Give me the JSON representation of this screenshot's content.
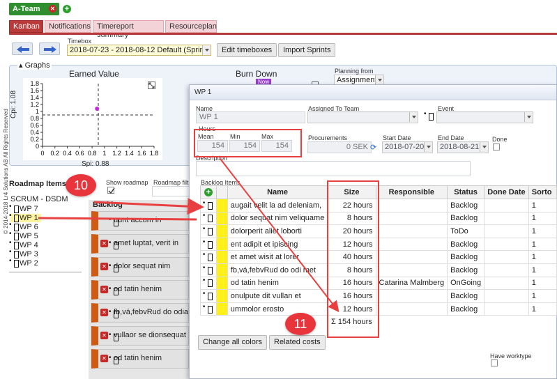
{
  "side_text": "© 2014-2018 Lr4 Solutions AB All Rights Reserved",
  "team_tab": {
    "label": "A-Team"
  },
  "nav_tabs": [
    "Kanban",
    "Notifications",
    "Timereport summary",
    "Resourceplan"
  ],
  "timebox": {
    "label": "Timebox",
    "value": "2018-07-23 - 2018-08-12 Default (Sprint)"
  },
  "toolbar": {
    "edit_timeboxes": "Edit timeboxes",
    "import_sprints": "Import Sprints"
  },
  "graphs": {
    "legend": "Graphs",
    "earned_value_title": "Earned Value",
    "burn_down_title": "Burn Down",
    "new_badge": "Now",
    "y_axis_label": "Cpi: 1.08",
    "x_axis_label": "Spi: 0.88",
    "y_ticks": [
      "1.8",
      "1.6",
      "1.4",
      "1.2",
      "1",
      "0.8",
      "0.6",
      "0.4",
      "0.2",
      "0"
    ],
    "x_ticks": [
      "0",
      "0.2",
      "0.4",
      "0.6",
      "0.8",
      "1",
      "1.2",
      "1.4",
      "1.6",
      "1.8"
    ],
    "planning_from_label": "Planning from",
    "planning_from_value": "Assignment"
  },
  "chart_data": {
    "type": "scatter",
    "title": "Earned Value",
    "xlabel": "Spi: 0.88",
    "ylabel": "Cpi: 1.08",
    "xlim": [
      0,
      1.8
    ],
    "ylim": [
      0,
      1.8
    ],
    "points": [
      {
        "x": 0.88,
        "y": 1.08
      }
    ],
    "reference_lines": {
      "x": 0.9,
      "y": 0.9
    },
    "grid": false
  },
  "roadmap": {
    "title": "Roadmap Items",
    "show_roadmap": "Show roadmap",
    "roadmap_filter": "Roadmap filte",
    "root": "SCRUM - DSDM",
    "items": [
      "WP 7",
      "WP 1",
      "WP 6",
      "WP 5",
      "WP 4",
      "WP 3",
      "WP 2"
    ],
    "selected": "WP 1"
  },
  "backlog": {
    "title": "Backlog",
    "cards": [
      "uunt accum in",
      "amet luptat, verit in",
      "dolor sequat nim",
      "od tatin henim",
      "fb,vá,febvRud do odiar",
      "vullaor se dionsequat",
      "od tatin henim"
    ]
  },
  "modal": {
    "title": "WP 1",
    "name_label": "Name",
    "name_value": "WP 1",
    "assigned_label": "Assigned To Team",
    "event_label": "Event",
    "hours_label": "Hours",
    "mean_label": "Mean",
    "min_label": "Min",
    "max_label": "Max",
    "mean_value": "154",
    "min_value": "154",
    "max_value": "154",
    "procurements_label": "Procurements",
    "procurements_value": "0 SEK",
    "start_date_label": "Start Date",
    "start_date_value": "2018-07-20",
    "end_date_label": "End Date",
    "end_date_value": "2018-08-21",
    "done_label": "Done",
    "description_label": "Description",
    "backlog_items_label": "Backlog Items",
    "columns": [
      "",
      "",
      "Name",
      "Size",
      "Responsible",
      "Status",
      "Done Date",
      "Sorto"
    ],
    "rows": [
      {
        "name": "augait velit la ad deleniam,",
        "size": "22 hours",
        "responsible": "",
        "status": "Backlog",
        "done_date": "",
        "sort": "1"
      },
      {
        "name": "dolor sequat nim veliquame",
        "size": "8 hours",
        "responsible": "",
        "status": "Backlog",
        "done_date": "",
        "sort": "1"
      },
      {
        "name": "dolorperit aliet loborti",
        "size": "20 hours",
        "responsible": "",
        "status": "ToDo",
        "done_date": "",
        "sort": "1"
      },
      {
        "name": "ent adipit et ipiscing",
        "size": "12 hours",
        "responsible": "",
        "status": "Backlog",
        "done_date": "",
        "sort": "1"
      },
      {
        "name": "et amet wisit at lorer",
        "size": "40 hours",
        "responsible": "",
        "status": "Backlog",
        "done_date": "",
        "sort": "1"
      },
      {
        "name": "fb,vá,febvRud do odi met",
        "size": "8 hours",
        "responsible": "",
        "status": "Backlog",
        "done_date": "",
        "sort": "1"
      },
      {
        "name": "od tatin henim",
        "size": "16 hours",
        "responsible": "Catarina Malmberg",
        "status": "OnGoing",
        "done_date": "",
        "sort": "1"
      },
      {
        "name": "onulpute dit vullan et",
        "size": "16 hours",
        "responsible": "",
        "status": "Backlog",
        "done_date": "",
        "sort": "1"
      },
      {
        "name": "ummolor erosto",
        "size": "12 hours",
        "responsible": "",
        "status": "Backlog",
        "done_date": "",
        "sort": "1"
      }
    ],
    "total": "Σ 154 hours",
    "change_colors": "Change all colors",
    "related_costs": "Related costs",
    "have_worktype": "Have worktype"
  },
  "callouts": {
    "c10": "10",
    "c11": "11"
  },
  "colors": {
    "team_green": "#2f8f2f",
    "tab_active": "#b83a3a",
    "callout_red": "#e8353b",
    "card_orange": "#d05a12",
    "row_yellow": "#ffef1a"
  }
}
